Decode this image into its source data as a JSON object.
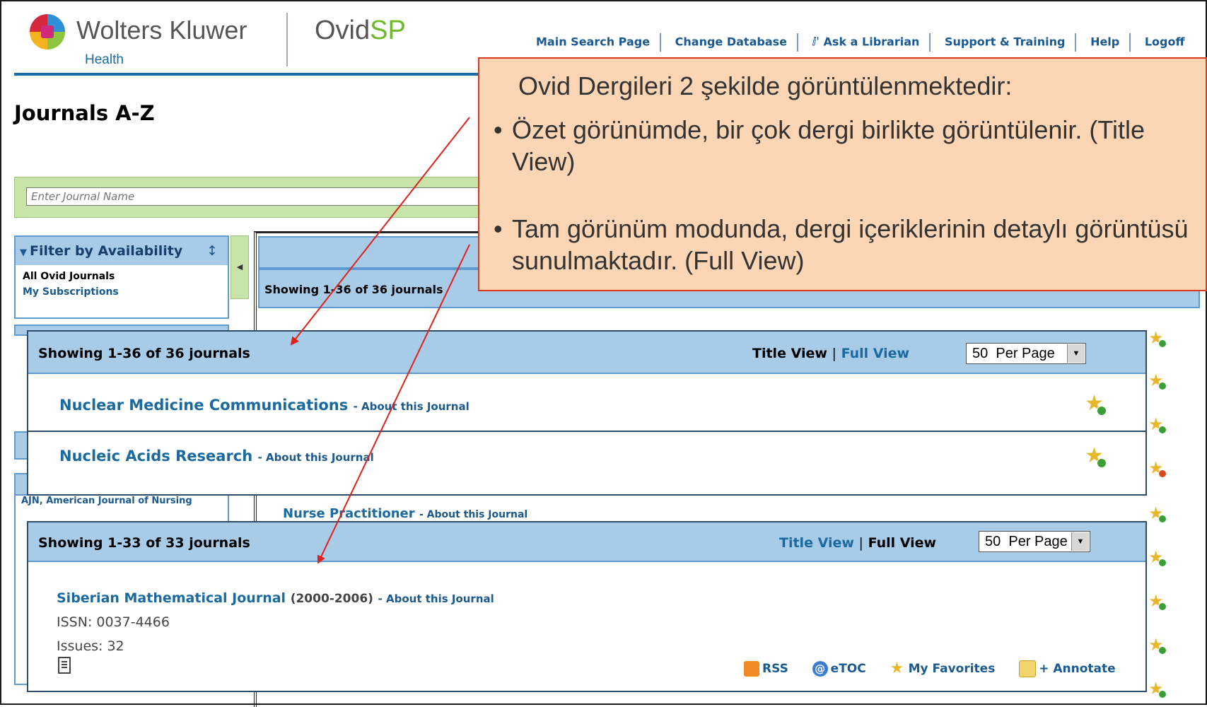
{
  "header": {
    "brand": "Wolters Kluwer",
    "brand_sub": "Health",
    "product_main": "Ovid",
    "product_accent": "SP",
    "nav": [
      "Main Search Page",
      "Change Database",
      "Ask a Librarian",
      "Support & Training",
      "Help",
      "Logoff"
    ]
  },
  "page": {
    "title": "Journals A-Z",
    "search_placeholder": "Enter Journal Name"
  },
  "sidebar": {
    "filter_title": "Filter by Availability",
    "items": [
      "All Ovid Journals",
      "My Subscriptions"
    ],
    "fragment_text": "AJN, American Journal of Nursing"
  },
  "background_list": {
    "showing": "Showing 1-36 of 36 journals",
    "row_title": "Nurse Practitioner",
    "row_about": "- About this Journal"
  },
  "title_view_panel": {
    "showing": "Showing 1-36 of 36 journals",
    "title_view": "Title View",
    "separator": "|",
    "full_view": "Full View",
    "per_page_value": "50",
    "per_page_label": "Per Page",
    "journals": [
      {
        "title": "Nuclear Medicine Communications",
        "about": "- About this Journal"
      },
      {
        "title": "Nucleic Acids Research",
        "about": "- About this Journal"
      }
    ]
  },
  "full_view_panel": {
    "showing": "Showing 1-33 of 33 journals",
    "title_view": "Title View",
    "separator": "|",
    "full_view": "Full View",
    "per_page_value": "50",
    "per_page_label": "Per Page",
    "journal": {
      "title": "Siberian Mathematical Journal",
      "years": "(2000-2006)",
      "about": "- About this Journal",
      "issn": "ISSN: 0037-4466",
      "issues": "Issues: 32"
    },
    "actions": [
      "RSS",
      "eTOC",
      "My Favorites",
      "+ Annotate"
    ]
  },
  "callout": {
    "heading": "Ovid Dergileri 2 şekilde görüntülenmektedir:",
    "bullets": [
      "Özet görünümde, bir çok dergi birlikte görüntülenir. (Title View)",
      "Tam görünüm modunda, dergi içeriklerinin detaylı görüntüsü sunulmaktadır. (Full View)"
    ]
  },
  "colors": {
    "accent_blue": "#1a6aa0",
    "header_blue": "#a8cbe8",
    "search_green": "#c9e4a8",
    "callout_fill": "#fbd5b4",
    "callout_border": "#d93a1e",
    "arrow_red": "#e0201a"
  }
}
